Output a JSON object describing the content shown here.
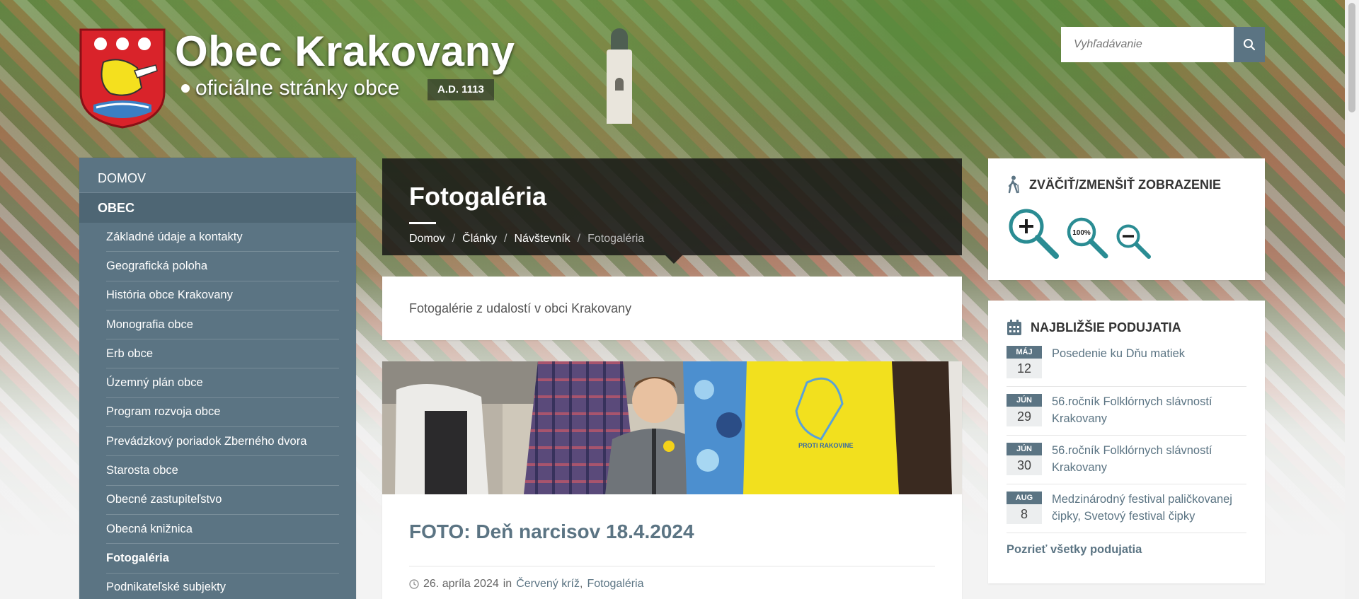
{
  "header": {
    "title": "Obec Krakovany",
    "subtitle": "oficiálne stránky obce",
    "founded": "A.D. 1113"
  },
  "search": {
    "placeholder": "Vyhľadávanie",
    "icon": "search-icon"
  },
  "sidebar": {
    "top_items": [
      {
        "label": "DOMOV"
      },
      {
        "label": "OBEC"
      }
    ],
    "items": [
      {
        "label": "Základné údaje a kontakty"
      },
      {
        "label": "Geografická poloha"
      },
      {
        "label": "História obce Krakovany"
      },
      {
        "label": "Monografia obce"
      },
      {
        "label": "Erb obce"
      },
      {
        "label": "Územný plán obce"
      },
      {
        "label": "Program rozvoja obce"
      },
      {
        "label": "Prevádzkový poriadok Zberného dvora"
      },
      {
        "label": "Starosta obce"
      },
      {
        "label": "Obecné zastupiteľstvo"
      },
      {
        "label": "Obecná knižnica"
      },
      {
        "label": "Fotogaléria",
        "active": true
      },
      {
        "label": "Podnikateľské subjekty"
      }
    ]
  },
  "page": {
    "title": "Fotogaléria",
    "breadcrumb": [
      "Domov",
      "Články",
      "Návštevník",
      "Fotogaléria"
    ],
    "breadcrumb_separator": "/",
    "intro": "Fotogalérie z udalostí v obci Krakovany"
  },
  "article": {
    "title": "FOTO: Deň narcisov 18.4.2024",
    "date": "26. apríla 2024",
    "in_label": "in",
    "categories": [
      "Červený kríž",
      "Fotogaléria"
    ],
    "category_separator": ",",
    "shirt_text": "PROTI RAKOVINE"
  },
  "zoom_widget": {
    "title": "ZVÄČIŤ/ZMENŠIŤ ZOBRAZENIE",
    "reset_label": "100%",
    "accent": "#2a8c93"
  },
  "events_widget": {
    "title": "NAJBLIŽŠIE PODUJATIA",
    "events": [
      {
        "month": "MÁJ",
        "day": "12",
        "title": "Posedenie ku Dňu matiek"
      },
      {
        "month": "JÚN",
        "day": "29",
        "title": "56.ročník Folklórnych slávností Krakovany"
      },
      {
        "month": "JÚN",
        "day": "30",
        "title": "56.ročník Folklórnych slávností Krakovany"
      },
      {
        "month": "AUG",
        "day": "8",
        "title": "Medzinárodný festival paličkovanej čipky, Svetový festival čipky"
      }
    ],
    "all_link": "Pozrieť všetky podujatia"
  },
  "colors": {
    "primary": "#5b7483",
    "header_overlay": "#141414",
    "zoom_icon": "#2a8c93"
  }
}
